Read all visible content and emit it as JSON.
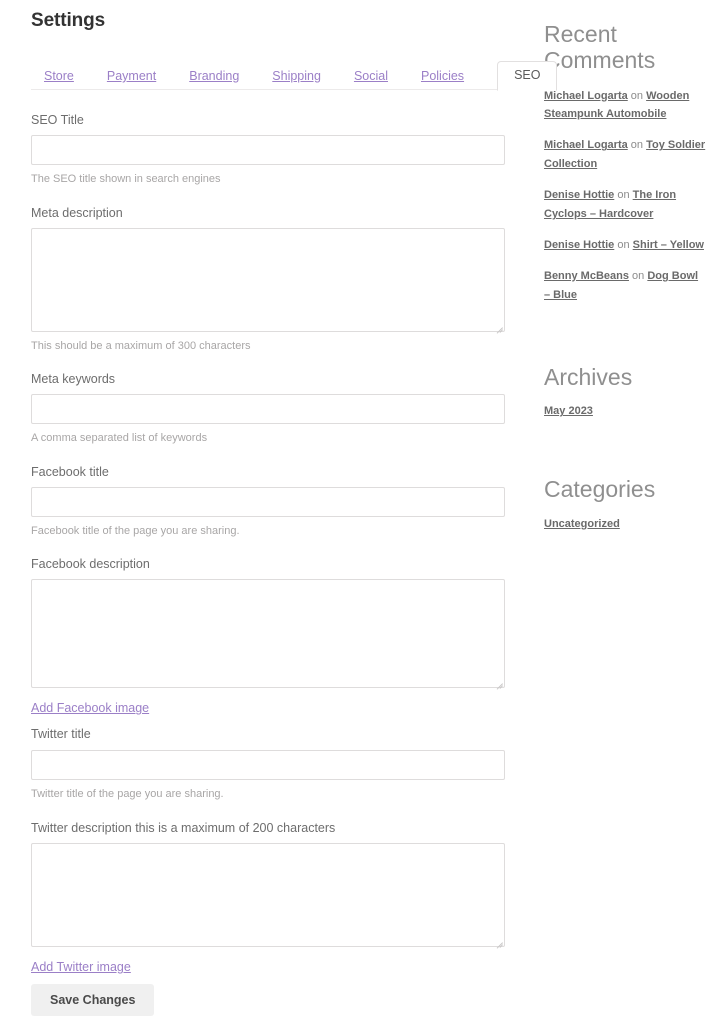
{
  "page": {
    "title": "Settings"
  },
  "tabs": [
    {
      "label": "Store",
      "active": false
    },
    {
      "label": "Payment",
      "active": false
    },
    {
      "label": "Branding",
      "active": false
    },
    {
      "label": "Shipping",
      "active": false
    },
    {
      "label": "Social",
      "active": false
    },
    {
      "label": "Policies",
      "active": false
    },
    {
      "label": "SEO",
      "active": true
    }
  ],
  "form": {
    "seo_title": {
      "label": "SEO Title",
      "value": "",
      "placeholder": "",
      "help": "The SEO title shown in search engines"
    },
    "meta_description": {
      "label": "Meta description",
      "value": "",
      "placeholder": "",
      "help": "This should be a maximum of 300 characters"
    },
    "meta_keywords": {
      "label": "Meta keywords",
      "value": "",
      "placeholder": "",
      "help": "A comma separated list of keywords"
    },
    "facebook_title": {
      "label": "Facebook title",
      "value": "",
      "placeholder": "",
      "help": "Facebook title of the page you are sharing."
    },
    "facebook_description": {
      "label": "Facebook description",
      "value": "",
      "placeholder": "",
      "help": ""
    },
    "add_facebook_image": "Add Facebook image",
    "twitter_title": {
      "label": "Twitter title",
      "value": "",
      "placeholder": "",
      "help": "Twitter title of the page you are sharing."
    },
    "twitter_description": {
      "label": "Twitter description this is a maximum of 200 characters",
      "value": "",
      "placeholder": "",
      "help": ""
    },
    "add_twitter_image": "Add Twitter image",
    "save_label": "Save Changes"
  },
  "sidebar": {
    "recent_comments": {
      "title": "Recent Comments",
      "items": [
        {
          "author": "Michael Logarta",
          "on": " on ",
          "post": "Wooden Steampunk Automobile"
        },
        {
          "author": "Michael Logarta",
          "on": " on ",
          "post": "Toy Soldier Collection"
        },
        {
          "author": "Denise  Hottie",
          "on": " on ",
          "post": "The Iron Cyclops – Hardcover"
        },
        {
          "author": "Denise  Hottie",
          "on": " on ",
          "post": "Shirt – Yellow"
        },
        {
          "author": "Benny  McBeans",
          "on": " on ",
          "post": "Dog Bowl – Blue"
        }
      ]
    },
    "archives": {
      "title": "Archives",
      "items": [
        {
          "label": "May 2023"
        }
      ]
    },
    "categories": {
      "title": "Categories",
      "items": [
        {
          "label": "Uncategorized"
        }
      ]
    }
  },
  "colors": {
    "link_purple": "#9b7fc7",
    "heading_dark": "#333333",
    "label_gray": "#6d6d6d",
    "help_gray": "#a8a6a6",
    "border_gray": "#dedcdc",
    "button_bg": "#f0f0f0"
  }
}
